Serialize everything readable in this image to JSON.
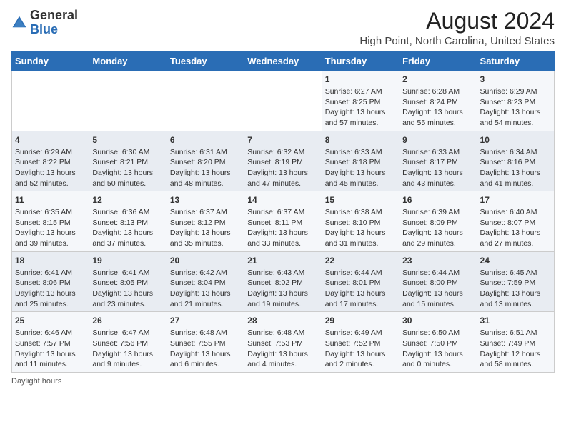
{
  "header": {
    "logo_general": "General",
    "logo_blue": "Blue",
    "title": "August 2024",
    "subtitle": "High Point, North Carolina, United States"
  },
  "days_of_week": [
    "Sunday",
    "Monday",
    "Tuesday",
    "Wednesday",
    "Thursday",
    "Friday",
    "Saturday"
  ],
  "weeks": [
    [
      {
        "num": "",
        "info": ""
      },
      {
        "num": "",
        "info": ""
      },
      {
        "num": "",
        "info": ""
      },
      {
        "num": "",
        "info": ""
      },
      {
        "num": "1",
        "info": "Sunrise: 6:27 AM\nSunset: 8:25 PM\nDaylight: 13 hours\nand 57 minutes."
      },
      {
        "num": "2",
        "info": "Sunrise: 6:28 AM\nSunset: 8:24 PM\nDaylight: 13 hours\nand 55 minutes."
      },
      {
        "num": "3",
        "info": "Sunrise: 6:29 AM\nSunset: 8:23 PM\nDaylight: 13 hours\nand 54 minutes."
      }
    ],
    [
      {
        "num": "4",
        "info": "Sunrise: 6:29 AM\nSunset: 8:22 PM\nDaylight: 13 hours\nand 52 minutes."
      },
      {
        "num": "5",
        "info": "Sunrise: 6:30 AM\nSunset: 8:21 PM\nDaylight: 13 hours\nand 50 minutes."
      },
      {
        "num": "6",
        "info": "Sunrise: 6:31 AM\nSunset: 8:20 PM\nDaylight: 13 hours\nand 48 minutes."
      },
      {
        "num": "7",
        "info": "Sunrise: 6:32 AM\nSunset: 8:19 PM\nDaylight: 13 hours\nand 47 minutes."
      },
      {
        "num": "8",
        "info": "Sunrise: 6:33 AM\nSunset: 8:18 PM\nDaylight: 13 hours\nand 45 minutes."
      },
      {
        "num": "9",
        "info": "Sunrise: 6:33 AM\nSunset: 8:17 PM\nDaylight: 13 hours\nand 43 minutes."
      },
      {
        "num": "10",
        "info": "Sunrise: 6:34 AM\nSunset: 8:16 PM\nDaylight: 13 hours\nand 41 minutes."
      }
    ],
    [
      {
        "num": "11",
        "info": "Sunrise: 6:35 AM\nSunset: 8:15 PM\nDaylight: 13 hours\nand 39 minutes."
      },
      {
        "num": "12",
        "info": "Sunrise: 6:36 AM\nSunset: 8:13 PM\nDaylight: 13 hours\nand 37 minutes."
      },
      {
        "num": "13",
        "info": "Sunrise: 6:37 AM\nSunset: 8:12 PM\nDaylight: 13 hours\nand 35 minutes."
      },
      {
        "num": "14",
        "info": "Sunrise: 6:37 AM\nSunset: 8:11 PM\nDaylight: 13 hours\nand 33 minutes."
      },
      {
        "num": "15",
        "info": "Sunrise: 6:38 AM\nSunset: 8:10 PM\nDaylight: 13 hours\nand 31 minutes."
      },
      {
        "num": "16",
        "info": "Sunrise: 6:39 AM\nSunset: 8:09 PM\nDaylight: 13 hours\nand 29 minutes."
      },
      {
        "num": "17",
        "info": "Sunrise: 6:40 AM\nSunset: 8:07 PM\nDaylight: 13 hours\nand 27 minutes."
      }
    ],
    [
      {
        "num": "18",
        "info": "Sunrise: 6:41 AM\nSunset: 8:06 PM\nDaylight: 13 hours\nand 25 minutes."
      },
      {
        "num": "19",
        "info": "Sunrise: 6:41 AM\nSunset: 8:05 PM\nDaylight: 13 hours\nand 23 minutes."
      },
      {
        "num": "20",
        "info": "Sunrise: 6:42 AM\nSunset: 8:04 PM\nDaylight: 13 hours\nand 21 minutes."
      },
      {
        "num": "21",
        "info": "Sunrise: 6:43 AM\nSunset: 8:02 PM\nDaylight: 13 hours\nand 19 minutes."
      },
      {
        "num": "22",
        "info": "Sunrise: 6:44 AM\nSunset: 8:01 PM\nDaylight: 13 hours\nand 17 minutes."
      },
      {
        "num": "23",
        "info": "Sunrise: 6:44 AM\nSunset: 8:00 PM\nDaylight: 13 hours\nand 15 minutes."
      },
      {
        "num": "24",
        "info": "Sunrise: 6:45 AM\nSunset: 7:59 PM\nDaylight: 13 hours\nand 13 minutes."
      }
    ],
    [
      {
        "num": "25",
        "info": "Sunrise: 6:46 AM\nSunset: 7:57 PM\nDaylight: 13 hours\nand 11 minutes."
      },
      {
        "num": "26",
        "info": "Sunrise: 6:47 AM\nSunset: 7:56 PM\nDaylight: 13 hours\nand 9 minutes."
      },
      {
        "num": "27",
        "info": "Sunrise: 6:48 AM\nSunset: 7:55 PM\nDaylight: 13 hours\nand 6 minutes."
      },
      {
        "num": "28",
        "info": "Sunrise: 6:48 AM\nSunset: 7:53 PM\nDaylight: 13 hours\nand 4 minutes."
      },
      {
        "num": "29",
        "info": "Sunrise: 6:49 AM\nSunset: 7:52 PM\nDaylight: 13 hours\nand 2 minutes."
      },
      {
        "num": "30",
        "info": "Sunrise: 6:50 AM\nSunset: 7:50 PM\nDaylight: 13 hours\nand 0 minutes."
      },
      {
        "num": "31",
        "info": "Sunrise: 6:51 AM\nSunset: 7:49 PM\nDaylight: 12 hours\nand 58 minutes."
      }
    ]
  ],
  "footer": {
    "label": "Daylight hours"
  }
}
